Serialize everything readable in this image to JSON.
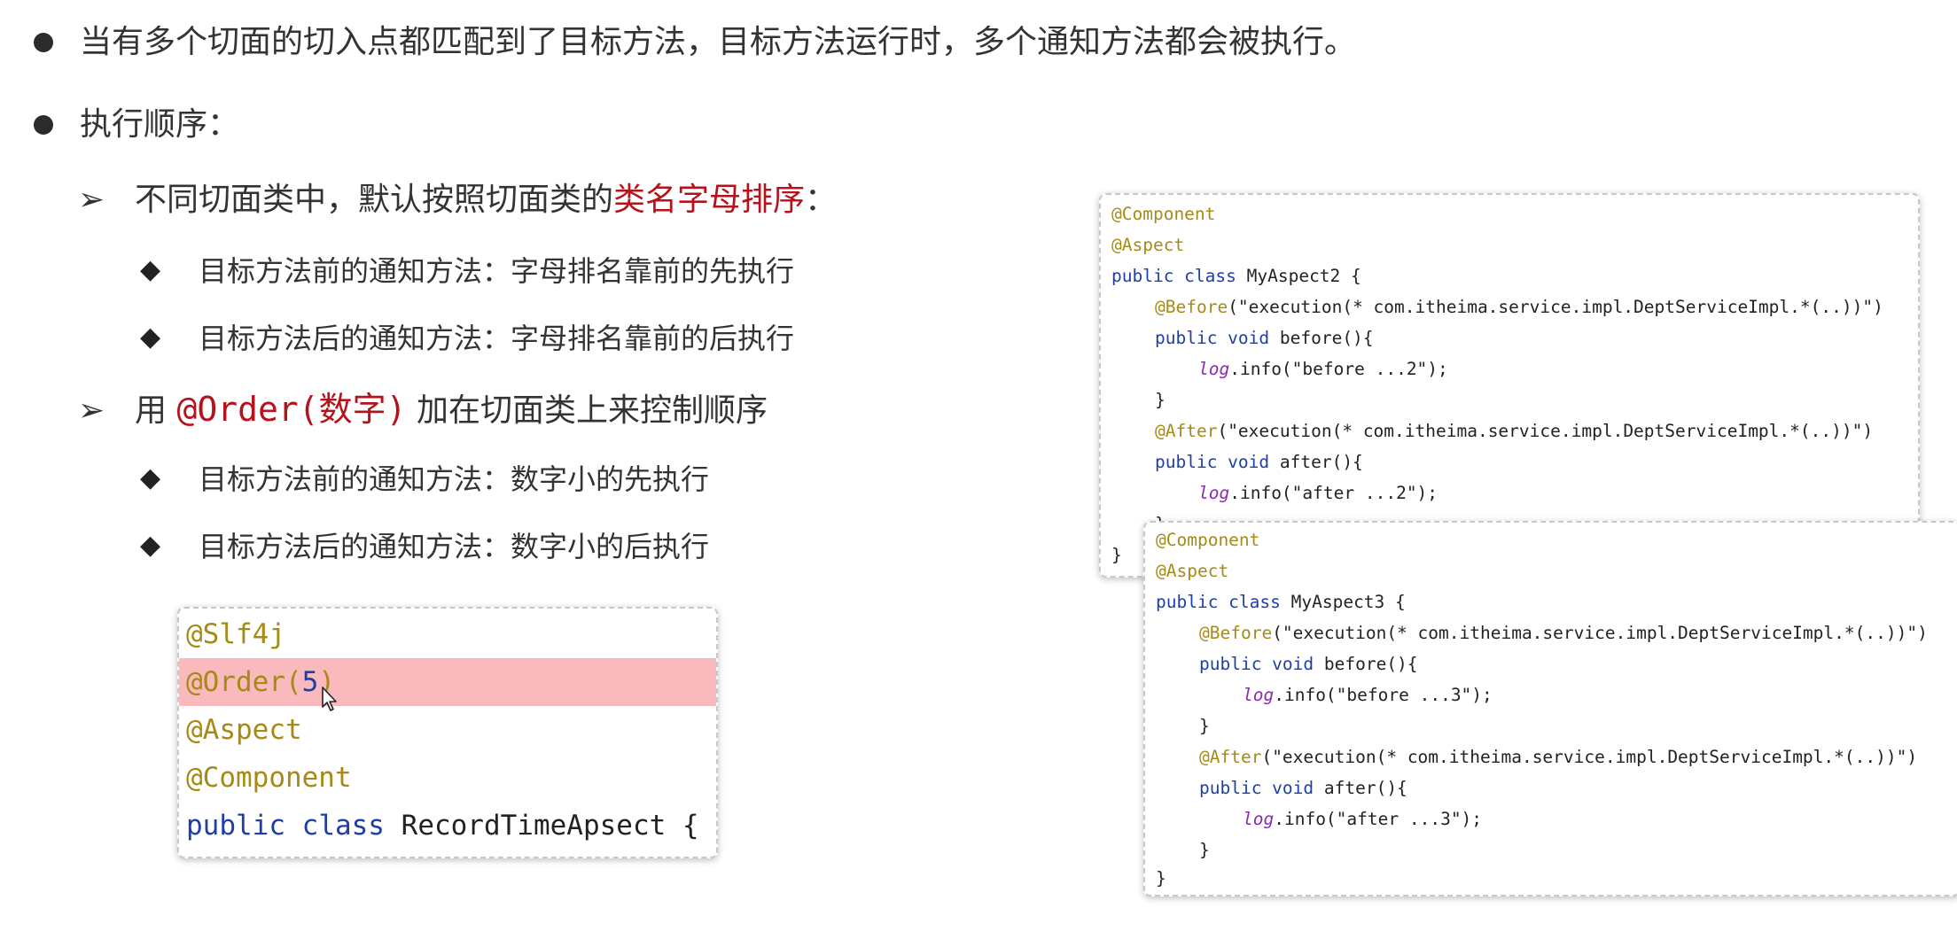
{
  "bullets": [
    "当有多个切面的切入点都匹配到了目标方法，目标方法运行时，多个通知方法都会被执行。",
    "执行顺序："
  ],
  "sub1": {
    "prefix": "不同切面类中，默认按照切面类的",
    "highlight": "类名字母排序",
    "suffix": "：",
    "items": [
      "目标方法前的通知方法：字母排名靠前的先执行",
      "目标方法后的通知方法：字母排名靠前的后执行"
    ]
  },
  "sub2": {
    "prefix": "用",
    "code": "@Order(数字)",
    "suffix": "加在切面类上来控制顺序",
    "items": [
      "目标方法前的通知方法：数字小的先执行",
      "目标方法后的通知方法：数字小的后执行"
    ]
  },
  "main_code": {
    "slf4j": "@Slf4j",
    "order_ann": "@Order(",
    "order_num": "5",
    "order_close": ")",
    "aspect": "@Aspect",
    "component": "@Component",
    "kw_public": "public",
    "kw_class": "class",
    "class_name": "RecordTimeApsect {"
  },
  "aspect2": {
    "component": "@Component",
    "aspect": "@Aspect",
    "kw": "public class",
    "class_decl": " MyAspect2 {",
    "before_ann": "@Before",
    "before_expr": "(\"execution(* com.itheima.service.impl.DeptServiceImpl.*(..))\")",
    "before_sig_kw": "public void",
    "before_sig": " before(){",
    "log": "log",
    "before_log": ".info(\"before ...2\");",
    "close": "}",
    "after_ann": "@After",
    "after_expr": "(\"execution(* com.itheima.service.impl.DeptServiceImpl.*(..))\")",
    "after_sig_kw": "public void",
    "after_sig": " after(){",
    "after_log": ".info(\"after ...2\");",
    "class_close": "}"
  },
  "aspect3": {
    "component": "@Component",
    "aspect": "@Aspect",
    "kw": "public class",
    "class_decl": " MyAspect3 {",
    "before_ann": "@Before",
    "before_expr": "(\"execution(* com.itheima.service.impl.DeptServiceImpl.*(..))\")",
    "before_sig_kw": "public void",
    "before_sig": " before(){",
    "log": "log",
    "before_log": ".info(\"before ...3\");",
    "close": "}",
    "after_ann": "@After",
    "after_expr": "(\"execution(* com.itheima.service.impl.DeptServiceImpl.*(..))\")",
    "after_sig_kw": "public void",
    "after_sig": " after(){",
    "after_log": ".info(\"after ...3\");",
    "class_close": "}"
  }
}
